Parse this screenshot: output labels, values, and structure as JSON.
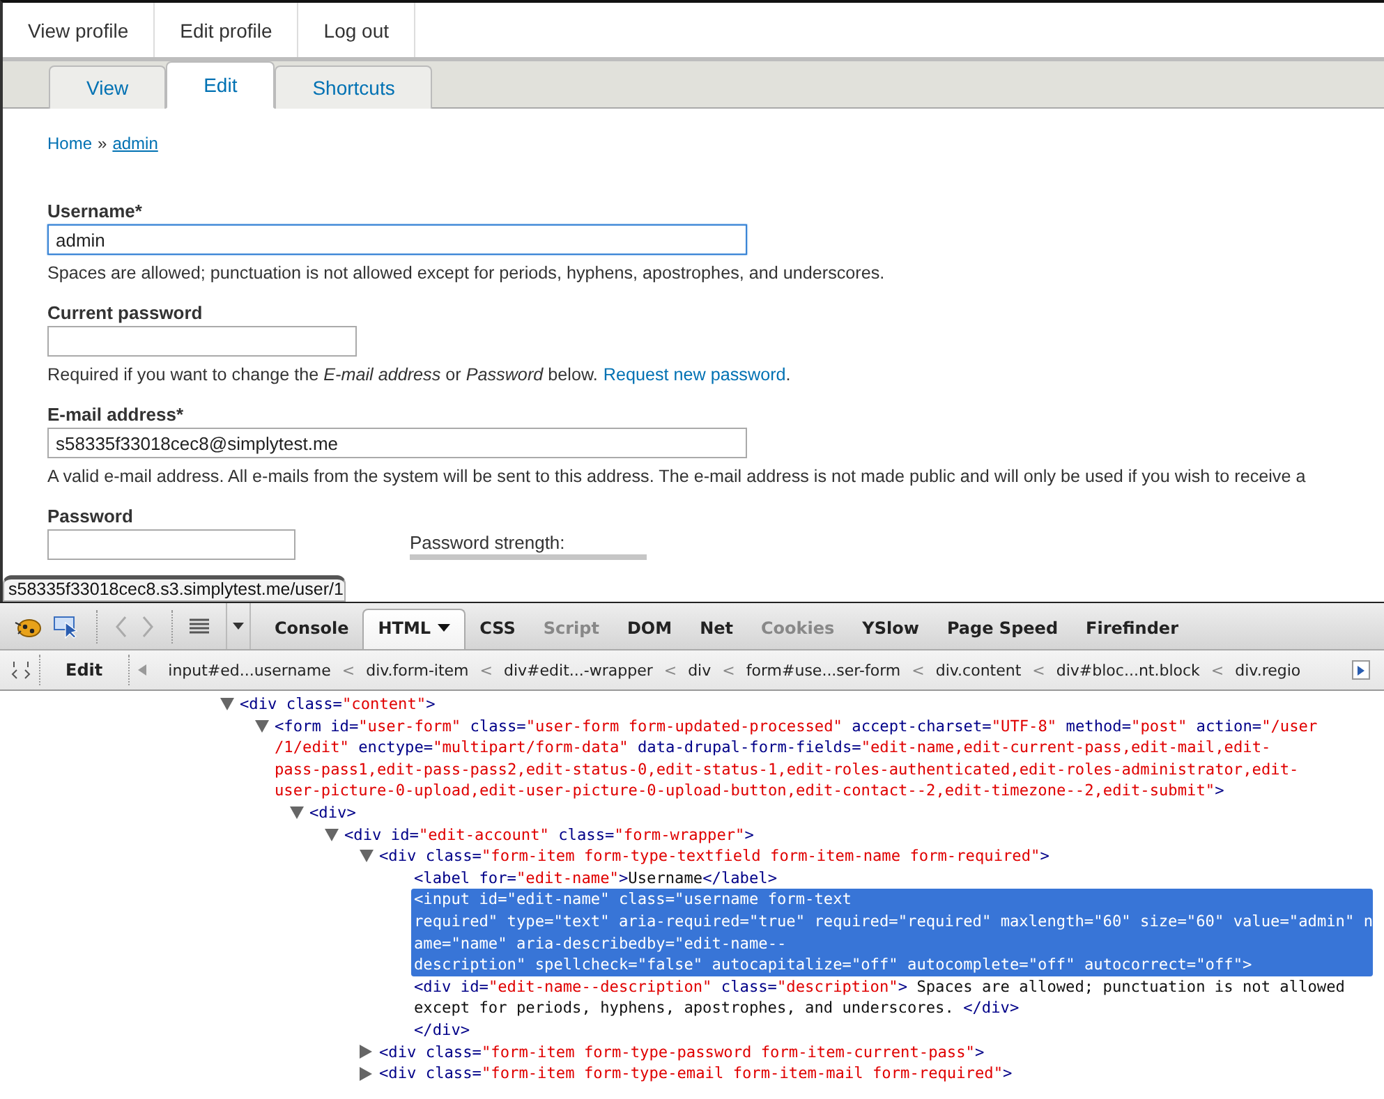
{
  "user_menu": [
    "View profile",
    "Edit profile",
    "Log out"
  ],
  "tabs": [
    {
      "label": "View",
      "selected": false
    },
    {
      "label": "Edit",
      "selected": true
    },
    {
      "label": "Shortcuts",
      "selected": false
    }
  ],
  "breadcrumb": [
    {
      "kind": "link",
      "text": "Home",
      "underlined": false
    },
    {
      "kind": "separator",
      "text": "»"
    },
    {
      "kind": "link",
      "text": "admin",
      "underlined": true
    }
  ],
  "form": {
    "fields": [
      {
        "kind": "username",
        "label": "Username",
        "required_mark": "*",
        "value": "admin",
        "focused": true,
        "description": "Spaces are allowed; punctuation is not allowed except for periods, hyphens, apostrophes, and underscores."
      },
      {
        "kind": "current",
        "label": "Current password",
        "focused": false,
        "description": "Required if you want to change the *E-mail address* or *Password* below.",
        "link": "Request new password",
        "link_after": "."
      },
      {
        "kind": "email",
        "label": "E-mail address",
        "required_mark": "*",
        "value": "s58335f33018cec8@simplytest.me",
        "focused": false,
        "description": "A valid e-mail address. All e-mails from the system will be sent to this address. The e-mail address is not made public and will only be used if you wish to receive a"
      },
      {
        "kind": "password",
        "label": "Password",
        "focused": false,
        "strength": {
          "label": "Password strength:",
          "level": 0
        }
      }
    ]
  },
  "status_url": "s58335f33018cec8.s3.simplytest.me/user/1",
  "devtools": {
    "panels": [
      {
        "label": "Console",
        "selected": false,
        "disabled": false
      },
      {
        "label": "HTML",
        "selected": true,
        "disabled": false,
        "menu": true
      },
      {
        "label": "CSS",
        "selected": false,
        "disabled": false
      },
      {
        "label": "Script",
        "selected": false,
        "disabled": true
      },
      {
        "label": "DOM",
        "selected": false,
        "disabled": false
      },
      {
        "label": "Net",
        "selected": false,
        "disabled": false
      },
      {
        "label": "Cookies",
        "selected": false,
        "disabled": true
      },
      {
        "label": "YSlow",
        "selected": false,
        "disabled": false
      },
      {
        "label": "Page Speed",
        "selected": false,
        "disabled": false
      },
      {
        "label": "Firefinder",
        "selected": false,
        "disabled": false
      }
    ],
    "edit_button": "Edit",
    "path": [
      {
        "kind": "element",
        "text": "input#ed...username"
      },
      {
        "kind": "separator",
        "text": "<"
      },
      {
        "kind": "element",
        "text": "div.form-item"
      },
      {
        "kind": "separator",
        "text": "<"
      },
      {
        "kind": "element",
        "text": "div#edit...-wrapper"
      },
      {
        "kind": "separator",
        "text": "<"
      },
      {
        "kind": "element",
        "text": "div"
      },
      {
        "kind": "separator",
        "text": "<"
      },
      {
        "kind": "element",
        "text": "form#use...ser-form"
      },
      {
        "kind": "separator",
        "text": "<"
      },
      {
        "kind": "element",
        "text": "div.content"
      },
      {
        "kind": "separator",
        "text": "<"
      },
      {
        "kind": "element",
        "text": "div#bloc...nt.block"
      },
      {
        "kind": "separator",
        "text": "<"
      },
      {
        "kind": "element",
        "text": "div.regio"
      }
    ],
    "tree": [
      {
        "expanded": true,
        "selected": false,
        "lines": [
          [
            {
              "kind": "tag",
              "text": "<div"
            },
            {
              "kind": "attr",
              "text": " class="
            },
            {
              "kind": "value",
              "text": "\"content\""
            },
            {
              "kind": "tag",
              "text": ">"
            }
          ]
        ],
        "children": [
          {
            "expanded": true,
            "selected": false,
            "lines": [
              [
                {
                  "kind": "tag",
                  "text": "<form"
                },
                {
                  "kind": "attr",
                  "text": " id="
                },
                {
                  "kind": "value",
                  "text": "\"user-form\""
                },
                {
                  "kind": "attr",
                  "text": " class="
                },
                {
                  "kind": "value",
                  "text": "\"user-form form-updated-processed\""
                },
                {
                  "kind": "attr",
                  "text": " accept-charset="
                },
                {
                  "kind": "value",
                  "text": "\"UTF-8\""
                },
                {
                  "kind": "attr",
                  "text": " method="
                },
                {
                  "kind": "value",
                  "text": "\"post\""
                },
                {
                  "kind": "attr",
                  "text": " action="
                },
                {
                  "kind": "value",
                  "text": "\"/user"
                }
              ],
              [
                {
                  "kind": "value",
                  "text": "/1/edit\""
                },
                {
                  "kind": "attr",
                  "text": " enctype="
                },
                {
                  "kind": "value",
                  "text": "\"multipart/form-data\""
                },
                {
                  "kind": "attr",
                  "text": " data-drupal-form-fields="
                },
                {
                  "kind": "value",
                  "text": "\"edit-name,edit-current-pass,edit-mail,edit-"
                }
              ],
              [
                {
                  "kind": "value",
                  "text": "pass-pass1,edit-pass-pass2,edit-status-0,edit-status-1,edit-roles-authenticated,edit-roles-administrator,edit-"
                }
              ],
              [
                {
                  "kind": "value",
                  "text": "user-picture-0-upload,edit-user-picture-0-upload-button,edit-contact--2,edit-timezone--2,edit-submit\""
                },
                {
                  "kind": "tag",
                  "text": ">"
                }
              ]
            ],
            "children": [
              {
                "expanded": true,
                "selected": false,
                "lines": [
                  [
                    {
                      "kind": "tag",
                      "text": "<div>"
                    }
                  ]
                ],
                "children": [
                  {
                    "expanded": true,
                    "selected": false,
                    "lines": [
                      [
                        {
                          "kind": "tag",
                          "text": "<div"
                        },
                        {
                          "kind": "attr",
                          "text": " id="
                        },
                        {
                          "kind": "value",
                          "text": "\"edit-account\""
                        },
                        {
                          "kind": "attr",
                          "text": " class="
                        },
                        {
                          "kind": "value",
                          "text": "\"form-wrapper\""
                        },
                        {
                          "kind": "tag",
                          "text": ">"
                        }
                      ]
                    ],
                    "children": [
                      {
                        "expanded": true,
                        "selected": false,
                        "lines": [
                          [
                            {
                              "kind": "tag",
                              "text": "<div"
                            },
                            {
                              "kind": "attr",
                              "text": " class="
                            },
                            {
                              "kind": "value",
                              "text": "\"form-item form-type-textfield form-item-name form-required\""
                            },
                            {
                              "kind": "tag",
                              "text": ">"
                            }
                          ]
                        ],
                        "closing": [
                          {
                            "kind": "tag",
                            "text": "</div>"
                          }
                        ],
                        "children": [
                          {
                            "selected": false,
                            "lines": [
                              [
                                {
                                  "kind": "tag",
                                  "text": "<label"
                                },
                                {
                                  "kind": "attr",
                                  "text": " for="
                                },
                                {
                                  "kind": "value",
                                  "text": "\"edit-name\""
                                },
                                {
                                  "kind": "tag",
                                  "text": ">"
                                },
                                {
                                  "kind": "text",
                                  "text": "Username"
                                },
                                {
                                  "kind": "tag",
                                  "text": "</label>"
                                }
                              ]
                            ]
                          },
                          {
                            "selected": true,
                            "lines": [
                              [
                                {
                                  "kind": "tag",
                                  "text": "<input"
                                },
                                {
                                  "kind": "attr",
                                  "text": " id="
                                },
                                {
                                  "kind": "value",
                                  "text": "\"edit-name\""
                                },
                                {
                                  "kind": "attr",
                                  "text": " class="
                                },
                                {
                                  "kind": "value",
                                  "text": "\"username form-text"
                                }
                              ],
                              [
                                {
                                  "kind": "value",
                                  "text": "required\""
                                },
                                {
                                  "kind": "attr",
                                  "text": " type="
                                },
                                {
                                  "kind": "value",
                                  "text": "\"text\""
                                },
                                {
                                  "kind": "attr",
                                  "text": " aria-required="
                                },
                                {
                                  "kind": "value",
                                  "text": "\"true\""
                                },
                                {
                                  "kind": "attr",
                                  "text": " required="
                                },
                                {
                                  "kind": "value",
                                  "text": "\"required\""
                                },
                                {
                                  "kind": "attr",
                                  "text": " maxlength="
                                },
                                {
                                  "kind": "value",
                                  "text": "\"60\""
                                },
                                {
                                  "kind": "attr",
                                  "text": " size="
                                },
                                {
                                  "kind": "value",
                                  "text": "\"60\""
                                },
                                {
                                  "kind": "attr",
                                  "text": " value="
                                },
                                {
                                  "kind": "value",
                                  "text": "\"admin\""
                                },
                                {
                                  "kind": "attr",
                                  "text": " n"
                                }
                              ],
                              [
                                {
                                  "kind": "attr",
                                  "text": "ame="
                                },
                                {
                                  "kind": "value",
                                  "text": "\"name\""
                                },
                                {
                                  "kind": "attr",
                                  "text": " aria-describedby="
                                },
                                {
                                  "kind": "value",
                                  "text": "\"edit-name--"
                                }
                              ],
                              [
                                {
                                  "kind": "value",
                                  "text": "description\""
                                },
                                {
                                  "kind": "attr",
                                  "text": " spellcheck="
                                },
                                {
                                  "kind": "value",
                                  "text": "\"false\""
                                },
                                {
                                  "kind": "attr",
                                  "text": " autocapitalize="
                                },
                                {
                                  "kind": "value",
                                  "text": "\"off\""
                                },
                                {
                                  "kind": "attr",
                                  "text": " autocomplete="
                                },
                                {
                                  "kind": "value",
                                  "text": "\"off\""
                                },
                                {
                                  "kind": "attr",
                                  "text": " autocorrect="
                                },
                                {
                                  "kind": "value",
                                  "text": "\"off\""
                                },
                                {
                                  "kind": "tag",
                                  "text": ">"
                                }
                              ]
                            ]
                          },
                          {
                            "selected": false,
                            "lines": [
                              [
                                {
                                  "kind": "tag",
                                  "text": "<div"
                                },
                                {
                                  "kind": "attr",
                                  "text": " id="
                                },
                                {
                                  "kind": "value",
                                  "text": "\"edit-name--description\""
                                },
                                {
                                  "kind": "attr",
                                  "text": " class="
                                },
                                {
                                  "kind": "value",
                                  "text": "\"description\""
                                },
                                {
                                  "kind": "tag",
                                  "text": ">"
                                },
                                {
                                  "kind": "text",
                                  "text": " Spaces are allowed; punctuation is not allowed"
                                }
                              ],
                              [
                                {
                                  "kind": "text",
                                  "text": "except for periods, hyphens, apostrophes, and underscores. "
                                },
                                {
                                  "kind": "tag",
                                  "text": "</div>"
                                }
                              ]
                            ]
                          }
                        ]
                      },
                      {
                        "expanded": false,
                        "selected": false,
                        "lines": [
                          [
                            {
                              "kind": "tag",
                              "text": "<div"
                            },
                            {
                              "kind": "attr",
                              "text": " class="
                            },
                            {
                              "kind": "value",
                              "text": "\"form-item form-type-password form-item-current-pass\""
                            },
                            {
                              "kind": "tag",
                              "text": ">"
                            }
                          ]
                        ]
                      },
                      {
                        "expanded": false,
                        "selected": false,
                        "lines": [
                          [
                            {
                              "kind": "tag",
                              "text": "<div"
                            },
                            {
                              "kind": "attr",
                              "text": " class="
                            },
                            {
                              "kind": "value",
                              "text": "\"form-item form-type-email form-item-mail form-required\""
                            },
                            {
                              "kind": "tag",
                              "text": ">"
                            }
                          ]
                        ]
                      }
                    ]
                  }
                ]
              }
            ]
          }
        ]
      }
    ]
  }
}
